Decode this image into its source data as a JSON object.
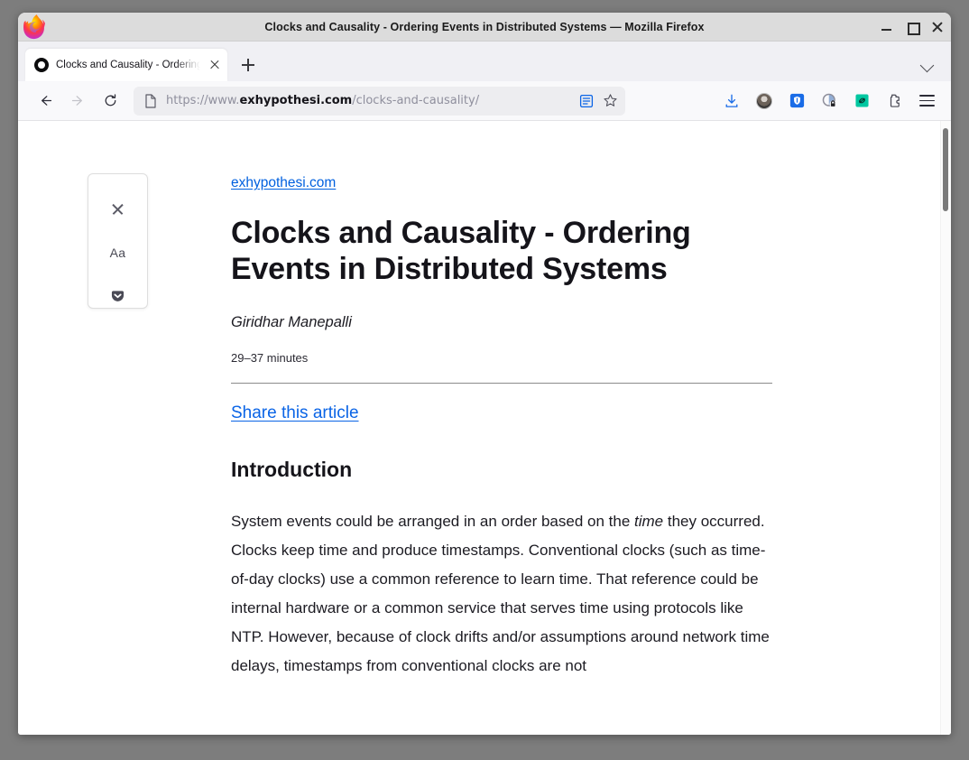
{
  "window": {
    "title": "Clocks and Causality - Ordering Events in Distributed Systems — Mozilla Firefox",
    "minimize_label": "Minimize",
    "maximize_label": "Maximize",
    "close_label": "Close"
  },
  "tabs": {
    "items": [
      {
        "title": "Clocks and Causality - Ordering",
        "favicon": "reader-mode-circle-icon",
        "close_label": "Close tab"
      }
    ],
    "new_tab_label": "Open a new tab",
    "list_all_label": "List all tabs"
  },
  "toolbar": {
    "back_label": "Go back one page",
    "forward_label": "Go forward one page",
    "reload_label": "Reload current page",
    "url": {
      "scheme": "https://www.",
      "domain": "exhypothesi.com",
      "path": "/clocks-and-causality/",
      "page_icon": "page-document-icon",
      "reader_view_label": "Toggle reader view",
      "bookmark_label": "Bookmark this page"
    },
    "right_icons": [
      {
        "name": "downloads-icon",
        "label": "Downloads"
      },
      {
        "name": "account-avatar-icon",
        "label": "Account"
      },
      {
        "name": "shield-password-manager-icon",
        "label": "1Password",
        "color": "#1a6ce7"
      },
      {
        "name": "privacy-badger-icon",
        "label": "Privacy extension"
      },
      {
        "name": "link-extension-icon",
        "label": "Link extension",
        "color": "#00c7a0"
      },
      {
        "name": "extensions-puzzle-icon",
        "label": "Extensions"
      },
      {
        "name": "application-menu-icon",
        "label": "Open application menu"
      }
    ]
  },
  "reader_toolbar": {
    "close_label": "Close Reader View",
    "type_controls_label": "Aa",
    "save_to_pocket_label": "Save to Pocket"
  },
  "article": {
    "site_name": "exhypothesi.com",
    "title": "Clocks and Causality - Ordering Events in Distributed Systems",
    "author": "Giridhar Manepalli",
    "read_time": "29–37 minutes",
    "share_link": "Share this article",
    "section_heading": "Introduction",
    "paragraph_part1": "System events could be arranged in an order based on the ",
    "paragraph_italic": "time",
    "paragraph_part2": " they occurred. Clocks keep time and produce timestamps. Conventional clocks (such as time-of-day clocks) use a common reference to learn time. That reference could be internal hardware or a common service that serves time using protocols like NTP. However, because of clock drifts and/or assumptions around network time delays, timestamps from conventional clocks are not"
  },
  "colors": {
    "link": "#0060df",
    "share_link": "#0a64e6",
    "text": "#1c1b22",
    "chrome_bg": "#f9f9fb",
    "desktop_bg": "#7d7d7d"
  }
}
